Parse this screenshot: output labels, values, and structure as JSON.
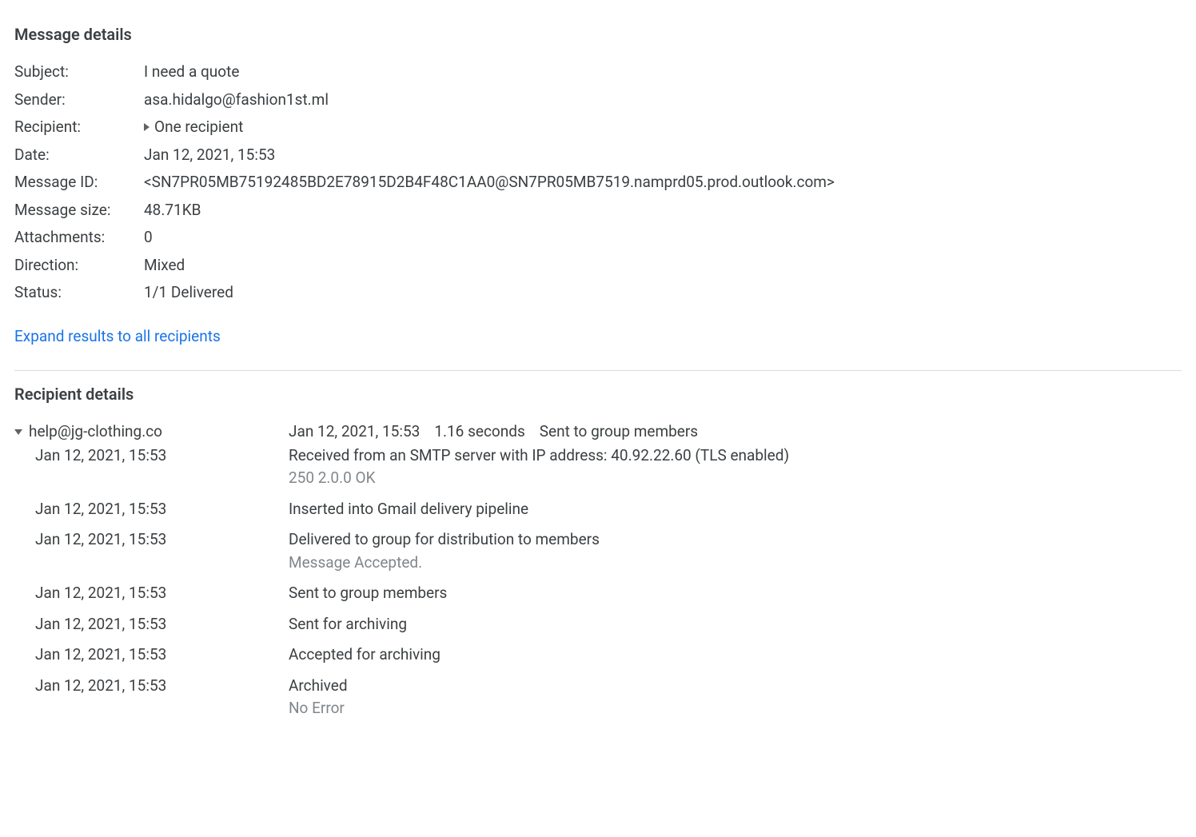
{
  "messageDetails": {
    "heading": "Message details",
    "rows": [
      {
        "label": "Subject:",
        "value": "I need a quote"
      },
      {
        "label": "Sender:",
        "value": "asa.hidalgo@fashion1st.ml"
      },
      {
        "label": "Recipient:",
        "value": "One recipient",
        "expandable": true
      },
      {
        "label": "Date:",
        "value": "Jan 12, 2021, 15:53"
      },
      {
        "label": "Message ID:",
        "value": "<SN7PR05MB75192485BD2E78915D2B4F48C1AA0@SN7PR05MB7519.namprd05.prod.outlook.com>"
      },
      {
        "label": "Message size:",
        "value": "48.71KB"
      },
      {
        "label": "Attachments:",
        "value": "0"
      },
      {
        "label": "Direction:",
        "value": "Mixed"
      },
      {
        "label": "Status:",
        "value": "1/1 Delivered"
      }
    ],
    "expandLink": "Expand results to all recipients"
  },
  "recipientDetails": {
    "heading": "Recipient details",
    "email": "help@jg-clothing.co",
    "summaryDate": "Jan 12, 2021, 15:53",
    "summaryDuration": "1.16 seconds",
    "summaryStatus": "Sent to group members",
    "events": [
      {
        "time": "Jan 12, 2021, 15:53",
        "text": "Received from an SMTP server with IP address: 40.92.22.60 (TLS enabled)",
        "sub": "250 2.0.0 OK"
      },
      {
        "time": "Jan 12, 2021, 15:53",
        "text": "Inserted into Gmail delivery pipeline"
      },
      {
        "time": "Jan 12, 2021, 15:53",
        "text": "Delivered to group for distribution to members",
        "sub": "Message Accepted."
      },
      {
        "time": "Jan 12, 2021, 15:53",
        "text": "Sent to group members"
      },
      {
        "time": "Jan 12, 2021, 15:53",
        "text": "Sent for archiving"
      },
      {
        "time": "Jan 12, 2021, 15:53",
        "text": "Accepted for archiving"
      },
      {
        "time": "Jan 12, 2021, 15:53",
        "text": "Archived",
        "sub": "No Error"
      }
    ]
  }
}
